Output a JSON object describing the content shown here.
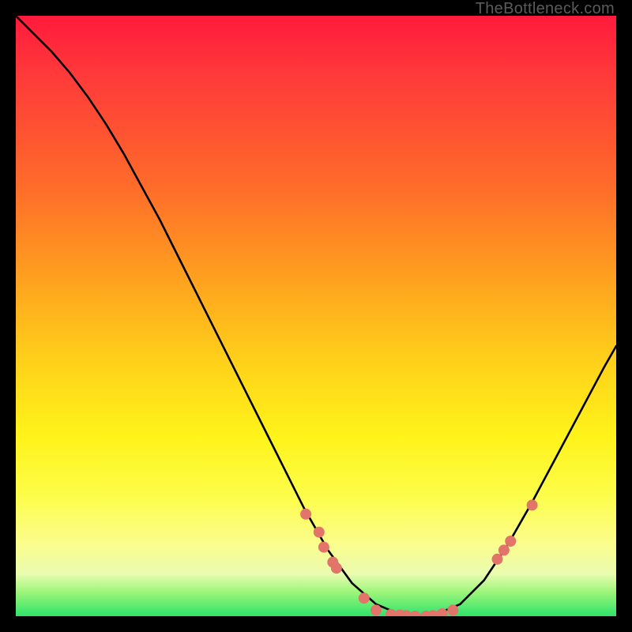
{
  "watermark": "TheBottleneck.com",
  "chart_data": {
    "type": "line",
    "title": "",
    "xlabel": "",
    "ylabel": "",
    "xlim": [
      0,
      100
    ],
    "ylim": [
      0,
      100
    ],
    "grid": false,
    "series": [
      {
        "name": "curve",
        "x": [
          0,
          3,
          6,
          9,
          12,
          15,
          18,
          21,
          24,
          27,
          30,
          33,
          36,
          39,
          42,
          45,
          48,
          52,
          56,
          60,
          64,
          67,
          70,
          74,
          78,
          82,
          86,
          90,
          94,
          98,
          100
        ],
        "y": [
          100,
          97,
          94,
          90.5,
          86.5,
          82,
          77,
          71.5,
          66,
          60,
          54,
          48,
          42,
          36,
          30,
          24,
          18,
          11,
          5.5,
          2,
          0.3,
          0,
          0.3,
          2,
          6,
          12,
          19,
          26.5,
          34,
          41.5,
          45
        ]
      }
    ],
    "markers": [
      {
        "x": 48.3,
        "y": 17
      },
      {
        "x": 50.5,
        "y": 14
      },
      {
        "x": 51.3,
        "y": 11.5
      },
      {
        "x": 52.8,
        "y": 9
      },
      {
        "x": 53.4,
        "y": 8
      },
      {
        "x": 58.0,
        "y": 3
      },
      {
        "x": 60.0,
        "y": 1.0
      },
      {
        "x": 62.5,
        "y": 0.3
      },
      {
        "x": 64.0,
        "y": 0.2
      },
      {
        "x": 65.0,
        "y": 0.1
      },
      {
        "x": 66.5,
        "y": 0.0
      },
      {
        "x": 68.3,
        "y": 0.0
      },
      {
        "x": 69.5,
        "y": 0.1
      },
      {
        "x": 71.0,
        "y": 0.4
      },
      {
        "x": 72.8,
        "y": 1.0
      },
      {
        "x": 80.2,
        "y": 9.5
      },
      {
        "x": 81.3,
        "y": 11
      },
      {
        "x": 82.4,
        "y": 12.5
      },
      {
        "x": 86.0,
        "y": 18.5
      }
    ],
    "marker_color": "#e2746a",
    "curve_color": "#000000",
    "legend": false
  }
}
